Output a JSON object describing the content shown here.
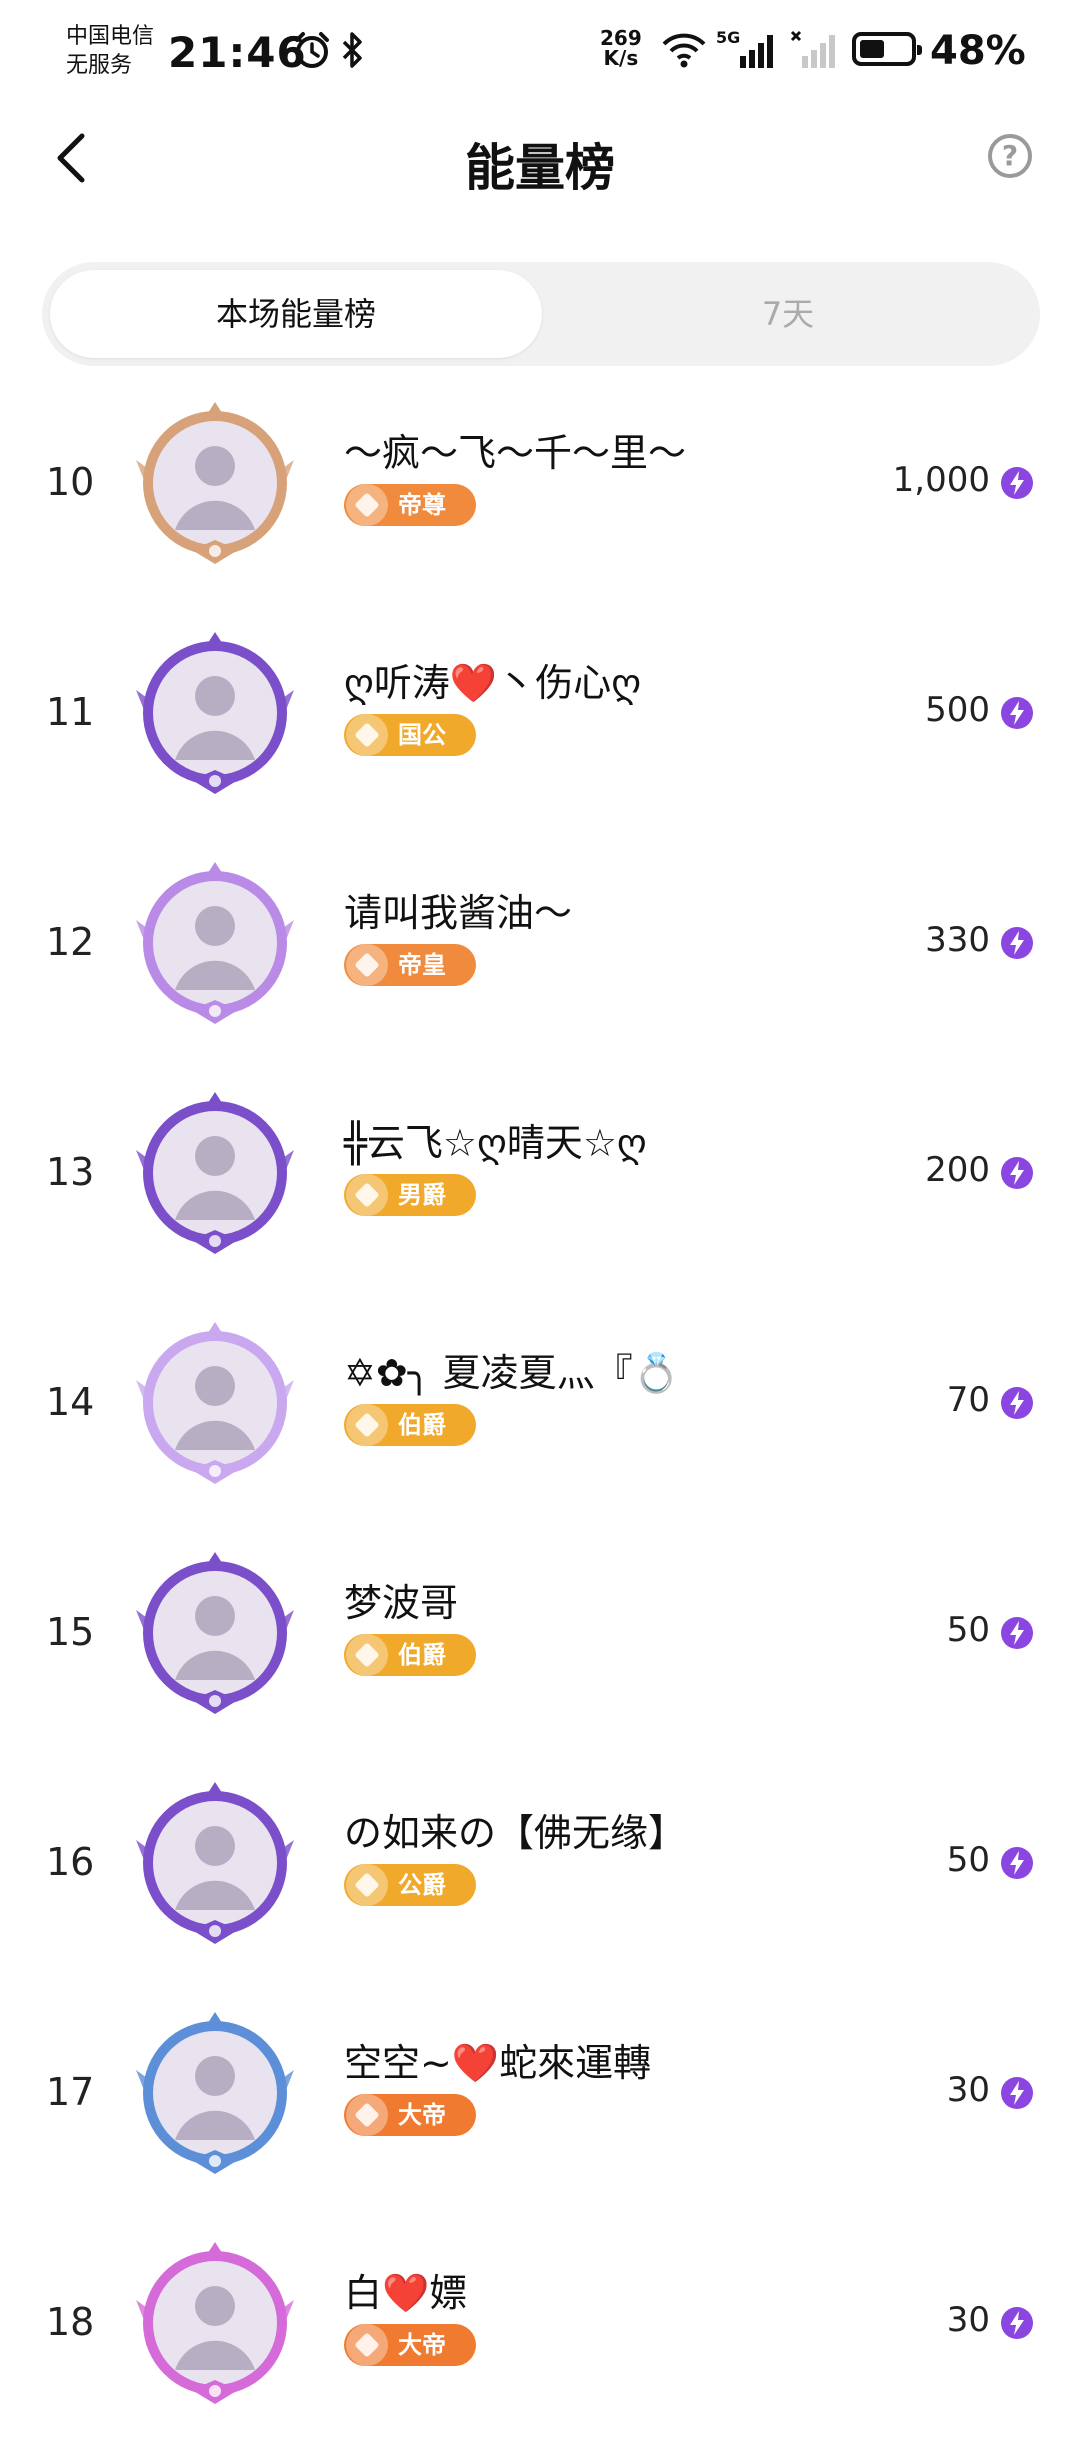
{
  "status_bar": {
    "carrier_line1": "中国电信",
    "carrier_line2": "无服务",
    "time": "21:46",
    "net_speed_value": "269",
    "net_speed_unit": "K/s",
    "network_type": "5G",
    "battery": "48%"
  },
  "header": {
    "title": "能量榜",
    "help_symbol": "?"
  },
  "tabs": [
    {
      "label": "本场能量榜",
      "active": true
    },
    {
      "label": "7天",
      "active": false
    }
  ],
  "rows": [
    {
      "rank": "10",
      "name": "～疯～飞～千～里～",
      "badge": "帝尊",
      "energy": "1,000",
      "frame": "#d7a27a",
      "badge_color": "#f08a3c"
    },
    {
      "rank": "11",
      "name": "ღ听涛❤️丶伤心ღ",
      "badge": "国公",
      "energy": "500",
      "frame": "#7b4fc9",
      "badge_color": "#f0a92a"
    },
    {
      "rank": "12",
      "name": "请叫我酱油～",
      "badge": "帝皇",
      "energy": "330",
      "frame": "#b98be6",
      "badge_color": "#f08a3c"
    },
    {
      "rank": "13",
      "name": "╬云飞☆ღ晴天☆ღ",
      "badge": "男爵",
      "energy": "200",
      "frame": "#7b4fc9",
      "badge_color": "#f0a92a"
    },
    {
      "rank": "14",
      "name": "✡✿╮ 夏凌夏灬『💍",
      "badge": "伯爵",
      "energy": "70",
      "frame": "#c9a8ef",
      "badge_color": "#f0a92a"
    },
    {
      "rank": "15",
      "name": "梦波哥",
      "badge": "伯爵",
      "energy": "50",
      "frame": "#7b4fc9",
      "badge_color": "#f0a92a"
    },
    {
      "rank": "16",
      "name": "の如来の【佛无缘】",
      "badge": "公爵",
      "energy": "50",
      "frame": "#7b4fc9",
      "badge_color": "#f0a92a"
    },
    {
      "rank": "17",
      "name": "空空~❤️蛇來運轉",
      "badge": "大帝",
      "energy": "30",
      "frame": "#5d8fd8",
      "badge_color": "#f07a30"
    },
    {
      "rank": "18",
      "name": "白❤️嫖",
      "badge": "大帝",
      "energy": "30",
      "frame": "#d46bd9",
      "badge_color": "#f07a30"
    }
  ]
}
